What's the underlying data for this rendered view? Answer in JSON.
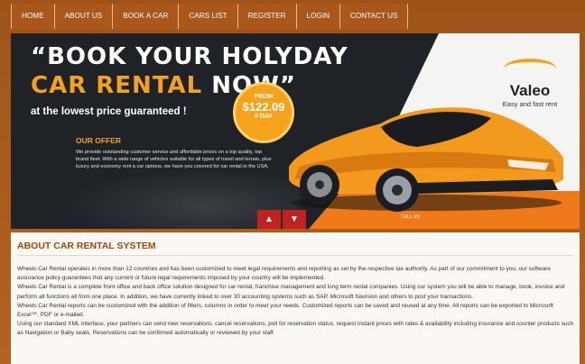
{
  "nav": {
    "items": [
      {
        "label": "HOME"
      },
      {
        "label": "ABOUT US"
      },
      {
        "label": "BOOK A CAR"
      },
      {
        "label": "CARS LIST"
      },
      {
        "label": "REGISTER"
      },
      {
        "label": "LOGIN"
      },
      {
        "label": "CONTACT US"
      }
    ]
  },
  "banner": {
    "headline_line1": "“BOOK YOUR HOLYDAY",
    "headline_line2_orange": "CAR RENTAL ",
    "headline_line2_white": "NOW”",
    "tagline": "at the lowest price guaranteed !",
    "price_from": "FROM",
    "price_amount": "$122.09",
    "price_per": "// DAY",
    "offer_title": "OUR OFFER",
    "offer_text": "We provide outstanding customer service and affordable prices on a top quality, top brand fleet. With a wide range of vehicles suitable for all types of travel and terrain, plus luxury and economy rent a car options, we have you covered for car rental in the USA.",
    "logo_name": "Valeo",
    "logo_sub": "Easy and fast rent",
    "call_label": "CALL US",
    "colors": {
      "accent": "#f5a11c",
      "orange": "#f07a1a",
      "red": "#c0221f",
      "dark": "#1f2226"
    }
  },
  "about": {
    "title": "ABOUT CAR RENTAL SYSTEM",
    "paragraphs": [
      "Wheels Car Rental operates in more than 12 countries and has been customized to meet legal requirements and reporting as set by the respective tax authority. As part of our commitment to you, our software assurance policy guarantees that any current or future legal requirements imposed by your country will be implemented.",
      "Wheels Car Rental is a complete front office and back office solution designed for car rental, franchise management and long term rental companies. Using our system you will be able to manage, book, invoice and perform all functions all from one place. In addition, we have currently linked to over 30 accounting systems such as SAP, Microsoft Navision and others to post your transactions.",
      "Wheels Car Rental reports can be customized with the addition of filters, columns in order to meet your needs. Customized reports can be saved and reused at any time. All reports can be exported to Microsoft Excel™, PDF or e-mailed.",
      "Using our standard XML interface, your partners can send new reservations, cancel reservations, poll for reservation status, request instant prices with rates & availability including insurance and counter products such as Navigation or Baby seats. Reservations can be confirmed automatically or reviewed by your staff."
    ]
  }
}
